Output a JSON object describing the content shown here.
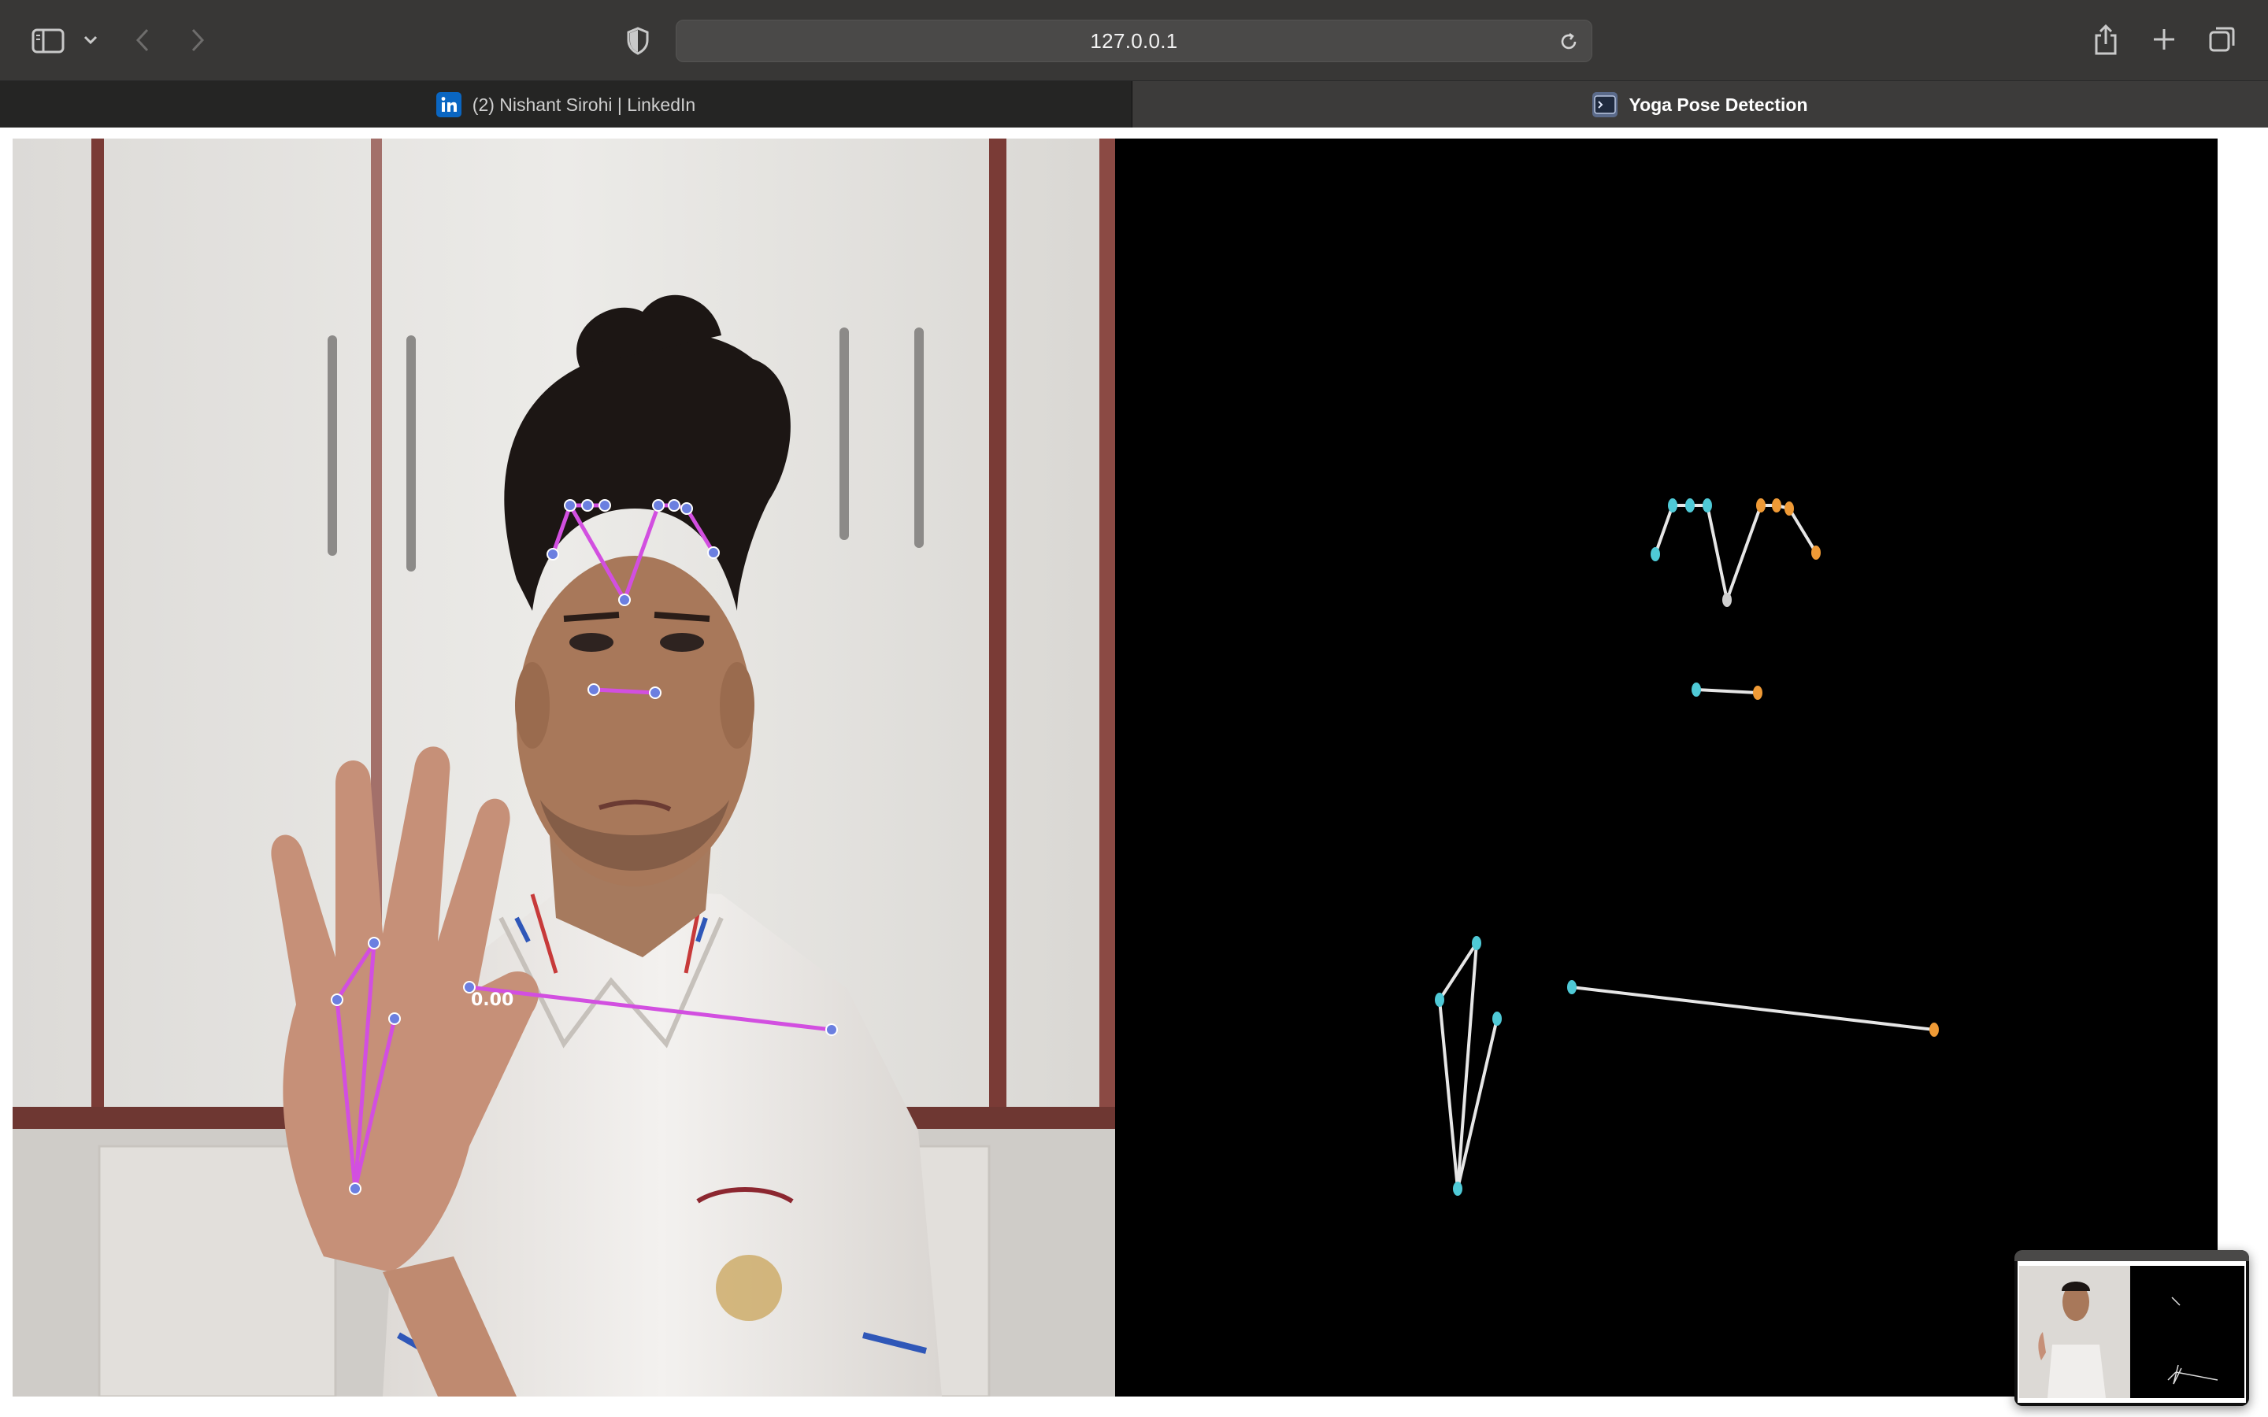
{
  "browser": {
    "address": "127.0.0.1",
    "tabs": [
      {
        "label": "(2) Nishant Sirohi | LinkedIn",
        "icon": "linkedin-icon",
        "active": false
      },
      {
        "label": "Yoga Pose Detection",
        "icon": "terminal-icon",
        "active": true
      }
    ]
  },
  "overlay": {
    "label_text": "0.00"
  },
  "colors": {
    "toolbar_bg": "#383736",
    "landmark_line": "#d24fe0",
    "landmark_point": "#6b7fe0",
    "skeleton_line": "#e6e6e6",
    "left_point": "#4fc9d6",
    "right_point": "#ef9a36"
  }
}
